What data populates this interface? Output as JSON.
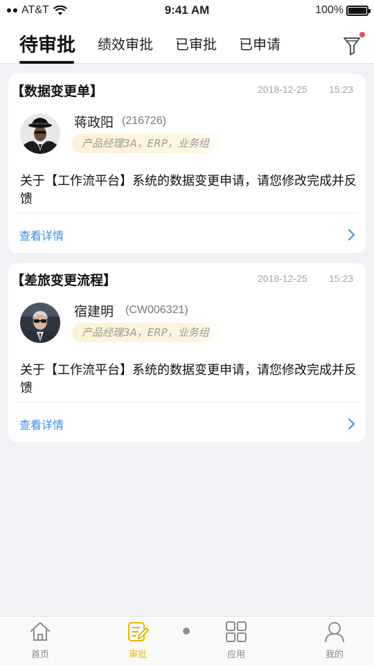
{
  "status_bar": {
    "carrier": "AT&T",
    "time": "9:41 AM",
    "battery": "100%"
  },
  "tabs": [
    {
      "label": "待审批",
      "active": true
    },
    {
      "label": "绩效审批",
      "active": false
    },
    {
      "label": "已审批",
      "active": false
    },
    {
      "label": "已申请",
      "active": false
    }
  ],
  "cards": [
    {
      "title": "【数据变更单】",
      "date": "2018-12-25",
      "time": "15:23",
      "name": "蒋政阳",
      "employee_id": "(216726)",
      "role": "产品经理3A，ERP，业务组",
      "message": "关于【工作流平台】系统的数据变更申请，请您修改完成并反馈",
      "detail_link": "查看详情"
    },
    {
      "title": "【差旅变更流程】",
      "date": "2018-12-25",
      "time": "15:23",
      "name": "宿建明",
      "employee_id": "(CW006321)",
      "role": "产品经理3A，ERP，业务组",
      "message": "关于【工作流平台】系统的数据变更申请，请您修改完成并反馈",
      "detail_link": "查看详情"
    }
  ],
  "bottom_nav": [
    {
      "label": "首页",
      "icon": "home-icon",
      "active": false
    },
    {
      "label": "审批",
      "icon": "approval-edit-icon",
      "active": true
    },
    {
      "label": "应用",
      "icon": "apps-grid-icon",
      "active": false
    },
    {
      "label": "我的",
      "icon": "user-icon",
      "active": false
    }
  ],
  "colors": {
    "accent_active": "#e8b800",
    "link": "#3a8ee6",
    "filter_dot": "#f0524f",
    "role_tag_bg": "#fdf3d6",
    "page_bg": "#f1f2f6"
  }
}
